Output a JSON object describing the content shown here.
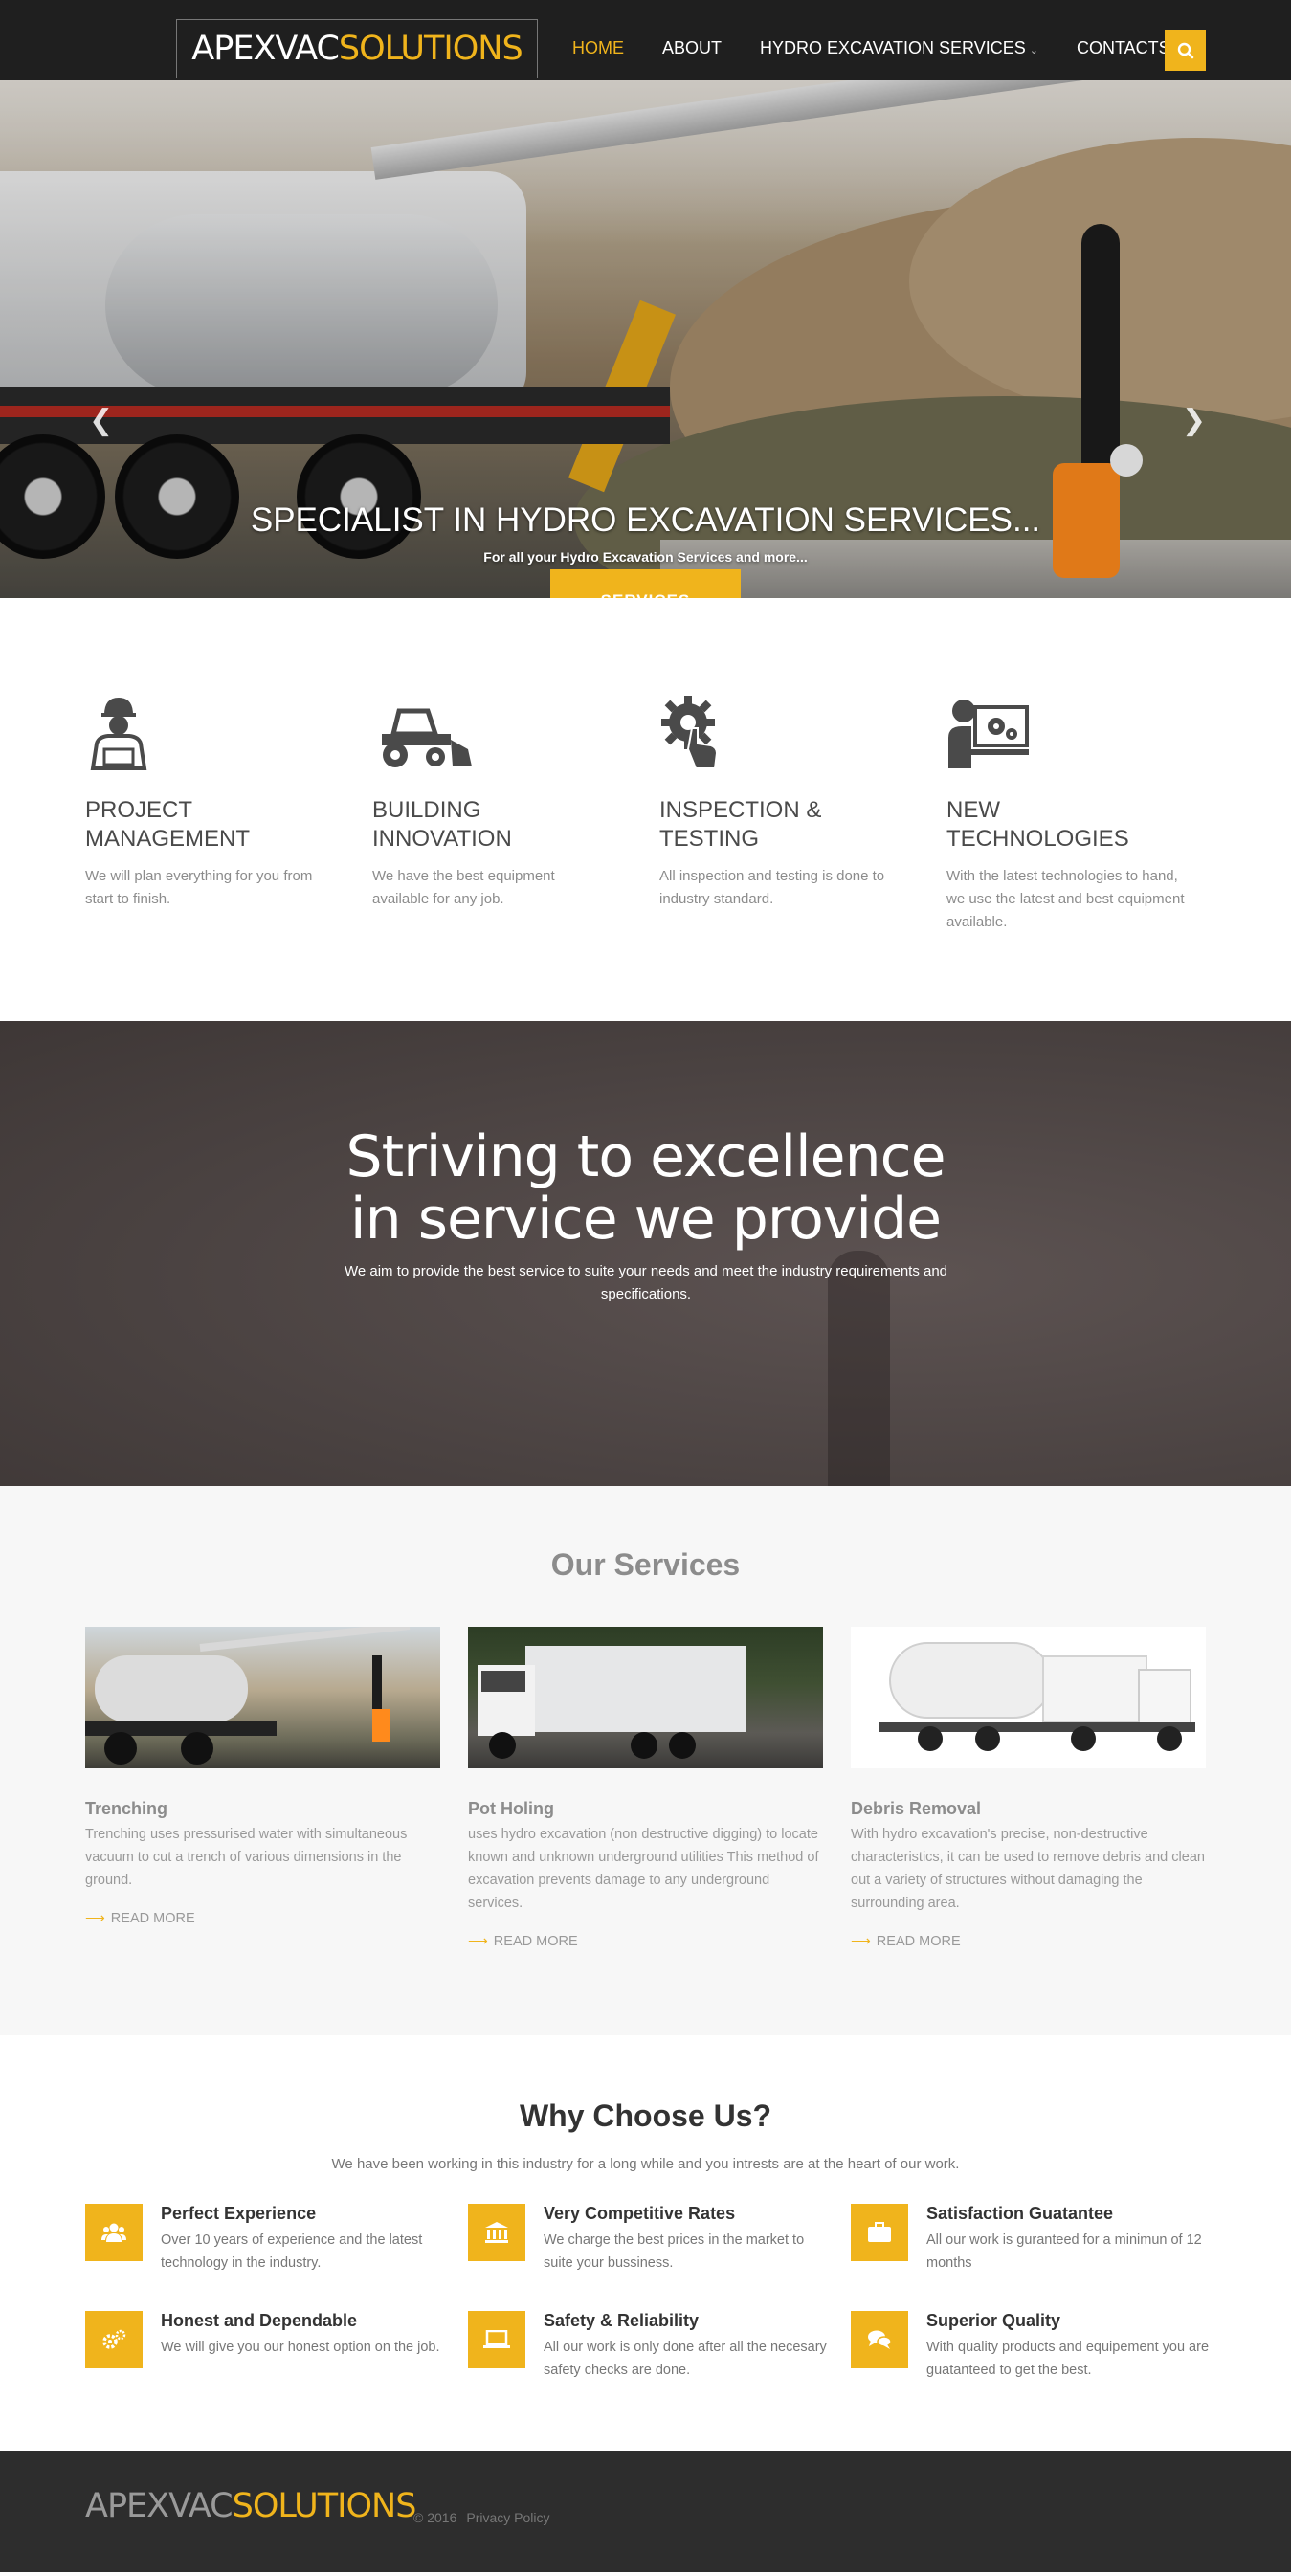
{
  "brand": {
    "part1": "APEXVAC",
    "part2": "SOLUTIONS"
  },
  "nav": {
    "items": [
      {
        "label": "HOME",
        "active": true
      },
      {
        "label": "ABOUT",
        "active": false
      },
      {
        "label": "HYDRO EXCAVATION SERVICES",
        "active": false,
        "has_dropdown": true
      },
      {
        "label": "CONTACTS",
        "active": false
      }
    ],
    "search_icon": "search-icon"
  },
  "hero": {
    "title": "SPECIALIST IN HYDRO EXCAVATION SERVICES...",
    "subtitle": "For all your Hydro Excavation Services and more...",
    "button": "SERVICES",
    "slides": 3,
    "active_slide": 1
  },
  "features": [
    {
      "icon": "worker-icon",
      "title": "PROJECT MANAGEMENT",
      "text": "We will plan everything for you from start to finish."
    },
    {
      "icon": "tractor-icon",
      "title": "BUILDING INNOVATION",
      "text": "We have the best equipment available for any job."
    },
    {
      "icon": "gear-hand-icon",
      "title": "INSPECTION & TESTING",
      "text": "All inspection and testing is done to industry standard."
    },
    {
      "icon": "computer-gear-icon",
      "title": "NEW TECHNOLOGIES",
      "text": "With the latest technologies to hand, we use the latest and best equipment available."
    }
  ],
  "strive": {
    "title_line1": "Striving to excellence",
    "title_line2": "in service we provide",
    "text": "We aim to provide the best service to suite your needs and meet the industry requirements and specifications."
  },
  "services": {
    "title": "Our Services",
    "items": [
      {
        "title": "Trenching",
        "text": "Trenching uses pressurised water with simultaneous vacuum to cut a trench of various dimensions in the ground.",
        "more": "READ MORE"
      },
      {
        "title": "Pot Holing",
        "text": "uses hydro excavation (non destructive digging) to locate known and unknown underground utilities This method of excavation prevents damage to any underground services.",
        "more": "READ MORE"
      },
      {
        "title": "Debris Removal",
        "text": "With hydro excavation's precise, non-destructive characteristics, it can be used to remove debris and clean out a variety of structures without damaging the surrounding area.",
        "more": "READ MORE"
      }
    ]
  },
  "why": {
    "title": "Why Choose Us?",
    "lead": "We have been working in this industry for a long while and you intrests are at the heart of our work.",
    "items": [
      {
        "icon": "users-icon",
        "title": "Perfect Experience",
        "text": "Over 10 years of experience and the latest technology in the industry."
      },
      {
        "icon": "bank-icon",
        "title": "Very Competitive Rates",
        "text": "We charge the best prices in the market to suite your bussiness."
      },
      {
        "icon": "briefcase-icon",
        "title": "Satisfaction Guatantee",
        "text": "All our work is guranteed for a minimun of 12 months"
      },
      {
        "icon": "cogs-icon",
        "title": "Honest and Dependable",
        "text": "We will give you our honest option on the job."
      },
      {
        "icon": "laptop-icon",
        "title": "Safety & Reliability",
        "text": "All our work is only done after all the necesary safety checks are done."
      },
      {
        "icon": "comments-icon",
        "title": "Superior Quality",
        "text": "With quality products and equipement you are guatanteed to get the best."
      }
    ]
  },
  "footer": {
    "brand1": "APEXVAC",
    "brand2": "SOLUTIONS",
    "copyright": "© 2016",
    "privacy": "Privacy Policy"
  },
  "colors": {
    "accent": "#f0b41c",
    "nav_bg": "#1f1f1f",
    "footer_bg": "#2d2d2d"
  }
}
